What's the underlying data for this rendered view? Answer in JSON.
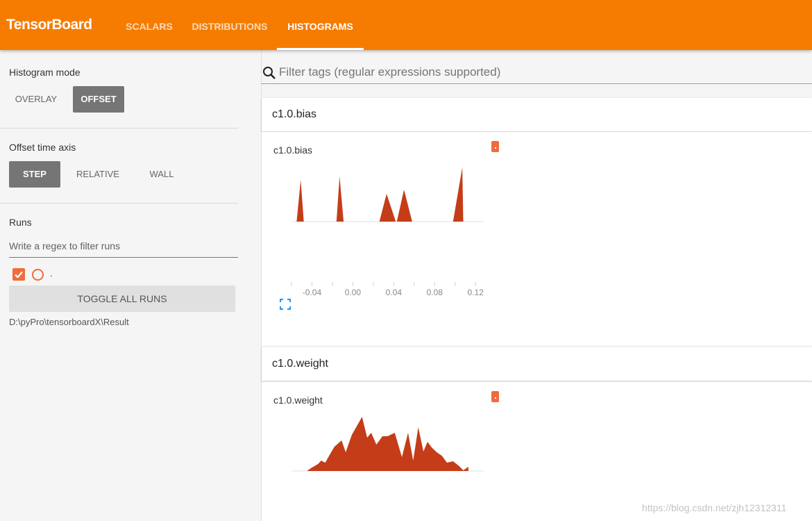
{
  "app": {
    "brand": "TensorBoard",
    "tabs": [
      {
        "label": "SCALARS",
        "active": false
      },
      {
        "label": "DISTRIBUTIONS",
        "active": false
      },
      {
        "label": "HISTOGRAMS",
        "active": true
      }
    ]
  },
  "sidebar": {
    "histogram_mode": {
      "title": "Histogram mode",
      "options": [
        "OVERLAY",
        "OFFSET"
      ],
      "selected": "OFFSET"
    },
    "offset_time_axis": {
      "title": "Offset time axis",
      "options": [
        "STEP",
        "RELATIVE",
        "WALL"
      ],
      "selected": "STEP"
    },
    "runs": {
      "title": "Runs",
      "filter_placeholder": "Write a regex to filter runs",
      "items": [
        {
          "name": ".",
          "checked": true
        }
      ],
      "toggle_label": "TOGGLE ALL RUNS",
      "logdir": "D:\\pyPro\\tensorboardX\\Result"
    }
  },
  "main": {
    "filter_placeholder": "Filter tags (regular expressions supported)",
    "categories": [
      {
        "name": "c1.0.bias",
        "card_title": "c1.0.bias",
        "run_color": "#ef6c3d"
      },
      {
        "name": "c1.0.weight",
        "card_title": "c1.0.weight",
        "run_color": "#ef6c3d"
      }
    ]
  },
  "watermark": "https://blog.csdn.net/zjh12312311",
  "colors": {
    "header": "#f57c00",
    "run": "#ef6c3d",
    "histogram_fill": "#c43d18",
    "selected_button": "#757575"
  },
  "chart_data": [
    {
      "type": "area",
      "title": "c1.0.bias",
      "x_ticks": [
        "-0.04",
        "0.00",
        "0.04",
        "0.08",
        "0.12"
      ],
      "xlim": [
        -0.06,
        0.128
      ],
      "x": [
        -0.055,
        -0.051,
        -0.048,
        -0.016,
        -0.013,
        -0.009,
        0.026,
        0.033,
        0.042,
        0.043,
        0.05,
        0.058,
        0.074,
        0.098,
        0.107,
        0.108
      ],
      "series": [
        {
          "values": [
            0,
            60,
            0,
            0,
            65,
            0,
            0,
            40,
            0,
            0,
            46,
            0,
            0,
            0,
            78,
            0
          ]
        }
      ]
    },
    {
      "type": "area",
      "title": "c1.0.weight",
      "xlim": [
        -0.06,
        0.128
      ],
      "x": [
        -0.045,
        -0.04,
        -0.034,
        -0.031,
        -0.027,
        -0.022,
        -0.018,
        -0.011,
        -0.007,
        -0.001,
        0.009,
        0.014,
        0.018,
        0.023,
        0.029,
        0.034,
        0.041,
        0.048,
        0.054,
        0.059,
        0.064,
        0.069,
        0.073,
        0.077,
        0.082,
        0.087,
        0.092,
        0.098,
        0.104,
        0.108,
        0.113
      ],
      "series": [
        {
          "values": [
            0,
            5,
            10,
            15,
            12,
            25,
            35,
            44,
            27,
            52,
            78,
            48,
            55,
            38,
            50,
            50,
            55,
            20,
            55,
            15,
            63,
            28,
            42,
            34,
            27,
            22,
            12,
            14,
            7,
            1,
            6
          ]
        }
      ]
    }
  ]
}
